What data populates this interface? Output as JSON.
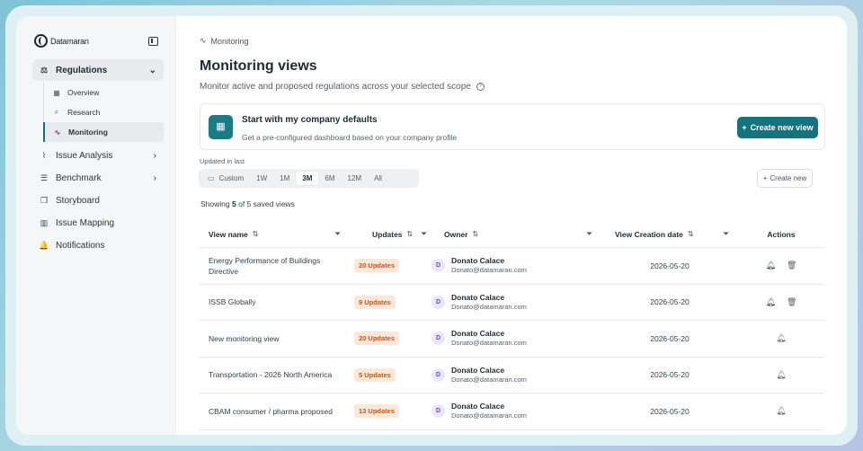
{
  "brand": {
    "name": "Datamaran"
  },
  "sidebar": {
    "regulations": {
      "label": "Regulations",
      "icon": "scale-icon",
      "chevron": "⌄"
    },
    "sub_items": [
      {
        "label": "Overview",
        "icon": "grid-icon",
        "glyph": "▦",
        "active": false
      },
      {
        "label": "Research",
        "icon": "search-icon",
        "glyph": "⌕",
        "active": false
      },
      {
        "label": "Monitoring",
        "icon": "pulse-icon",
        "glyph": "∿",
        "active": true
      }
    ],
    "items": [
      {
        "label": "Issue Analysis",
        "icon": "chart-icon",
        "glyph": "⌇",
        "chevron": "›"
      },
      {
        "label": "Benchmark",
        "icon": "bar-chart-icon",
        "glyph": "☰",
        "chevron": "›"
      },
      {
        "label": "Storyboard",
        "icon": "storyboard-icon",
        "glyph": "❐",
        "chevron": ""
      },
      {
        "label": "Issue Mapping",
        "icon": "map-icon",
        "glyph": "▥",
        "chevron": ""
      },
      {
        "label": "Notifications",
        "icon": "bell-icon",
        "glyph": "🔔",
        "chevron": ""
      }
    ]
  },
  "breadcrumb": {
    "label": "Monitoring"
  },
  "page": {
    "title": "Monitoring views",
    "subtitle": "Monitor active and proposed regulations across your selected scope"
  },
  "defaults_card": {
    "title": "Start with my company defaults",
    "description": "Get a pre-configured dashboard based on your company profile",
    "button_label": "Create new view"
  },
  "filters": {
    "updated_label": "Updated in last",
    "ranges": [
      "Custom",
      "1W",
      "1M",
      "3M",
      "6M",
      "12M",
      "All"
    ],
    "selected": "3M",
    "create_label": "Create new"
  },
  "showing": {
    "prefix": "Showing",
    "count": "5",
    "suffix": "of 5 saved views"
  },
  "table": {
    "headers": {
      "name": "View name",
      "updates": "Updates",
      "owner": "Owner",
      "date": "View Creation date",
      "actions": "Actions"
    },
    "rows": [
      {
        "name": "Energy Performance of Buildings Directive",
        "updates": "20 Updates",
        "avatar": "D",
        "owner": "Donato Calace",
        "email": "Donato@datamaran.com",
        "date": "2026-05-20",
        "bell_filled": true,
        "deletable": true
      },
      {
        "name": "ISSB Globally",
        "updates": "9 Updates",
        "avatar": "D",
        "owner": "Donato Calace",
        "email": "Donato@datamaran.com",
        "date": "2026-05-20",
        "bell_filled": true,
        "deletable": true
      },
      {
        "name": "New monitoring view",
        "updates": "20 Updates",
        "avatar": "D",
        "owner": "Donato Calace",
        "email": "Donato@datamaran.com",
        "date": "2026-05-20",
        "bell_filled": false,
        "deletable": false
      },
      {
        "name": "Transportation - 2026 North America",
        "updates": "5 Updates",
        "avatar": "D",
        "owner": "Donato Calace",
        "email": "Donato@datamaran.com",
        "date": "2026-05-20",
        "bell_filled": false,
        "deletable": false
      },
      {
        "name": "CBAM consumer / pharma proposed",
        "updates": "13 Updates",
        "avatar": "D",
        "owner": "Donato Calace",
        "email": "Donato@datamaran.com",
        "date": "2026-05-20",
        "bell_filled": false,
        "deletable": false
      }
    ]
  },
  "colors": {
    "accent": "#16727e",
    "badge_bg": "#fde7d9",
    "badge_text": "#c5561b",
    "avatar_bg": "#ece6fb"
  }
}
